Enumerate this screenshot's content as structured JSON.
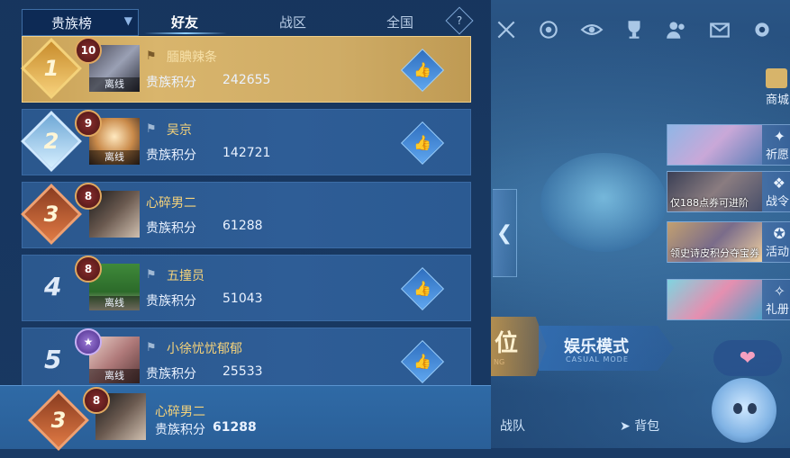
{
  "leaderboard": {
    "selector": "贵族榜",
    "tabs": [
      "好友",
      "战区",
      "全国"
    ],
    "help": "?",
    "score_label": "贵族积分",
    "offline_label": "离线",
    "rows": [
      {
        "rank": "1",
        "level": "10",
        "name": "腼腆辣条",
        "score": "242655",
        "offline": true
      },
      {
        "rank": "2",
        "level": "9",
        "name": "吴京",
        "score": "142721",
        "offline": true
      },
      {
        "rank": "3",
        "level": "8",
        "name": "心碎男二",
        "score": "61288",
        "offline": false
      },
      {
        "rank": "4",
        "level": "8",
        "name": "五撞员",
        "score": "51043",
        "offline": true
      },
      {
        "rank": "5",
        "level": "",
        "name": "小徐忧忧郁郁",
        "score": "25533",
        "offline": true
      }
    ],
    "me": {
      "rank": "3",
      "level": "8",
      "name": "心碎男二",
      "score": "61288"
    }
  },
  "right": {
    "shop": "商城",
    "menu": [
      {
        "caption": "",
        "side": "祈愿"
      },
      {
        "caption": "仅188点券可进阶",
        "side": "战令"
      },
      {
        "caption": "领史诗皮积分夺宝券",
        "side": "活动"
      },
      {
        "caption": "",
        "side": "礼册"
      }
    ],
    "mode_left": "位",
    "mode_left_sub": "NG",
    "mode_title": "娱乐模式",
    "mode_sub": "CASUAL MODE",
    "team": "战队",
    "bag": "背包"
  },
  "colors": {
    "gold_row": "#d9b56c",
    "panel": "#16345c",
    "name_gold": "#f6d37a",
    "like_blue": "#3f86d8"
  }
}
